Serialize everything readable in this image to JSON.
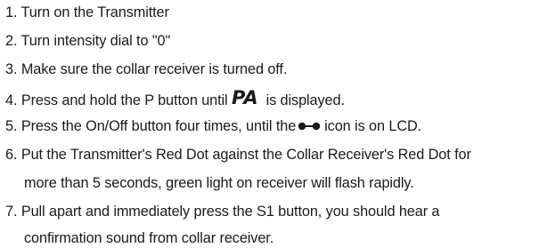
{
  "steps": [
    {
      "num": "1.",
      "text": "Turn on the Transmitter"
    },
    {
      "num": "2.",
      "text": "Turn intensity dial to \"0\""
    },
    {
      "num": "3.",
      "text": "Make sure the collar receiver is turned off."
    },
    {
      "num": "4.",
      "text_before": "Press and hold the P button until",
      "icon": "pa-lcd-icon",
      "icon_text": "PA",
      "text_after": "is displayed."
    },
    {
      "num": "5.",
      "text_before": "Press the On/Off button four times, until the",
      "icon": "dot-dash-dot-icon",
      "text_after": "icon is on LCD."
    },
    {
      "num": "6.",
      "line1": "Put the Transmitter's Red Dot against the Collar Receiver's Red Dot for",
      "line2": "more than 5 seconds, green light on receiver will flash rapidly."
    },
    {
      "num": "7.",
      "line1": "Pull apart and immediately press the S1 button, you should hear a",
      "line2": "confirmation sound from collar receiver."
    }
  ]
}
